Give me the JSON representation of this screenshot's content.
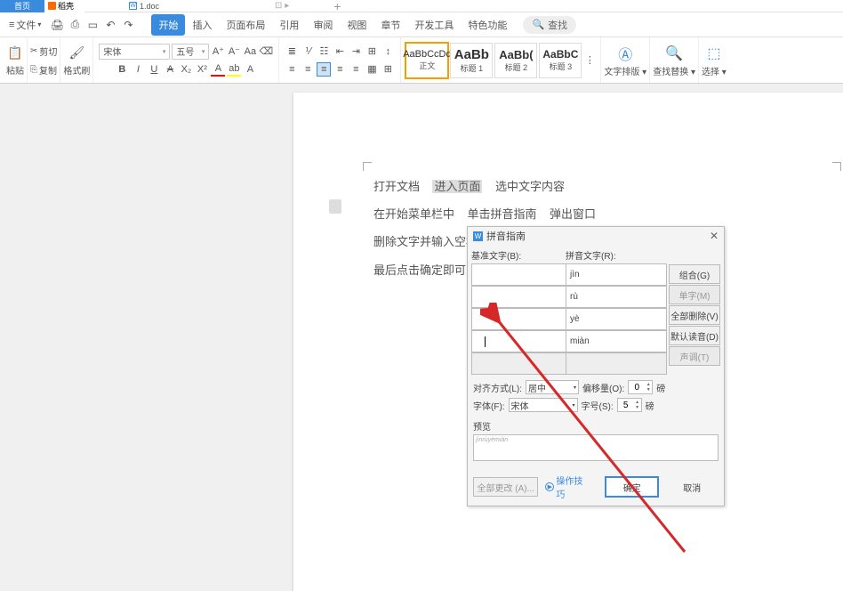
{
  "tabs": {
    "home": "首页",
    "kdocs": "稻壳",
    "doc": "1.doc",
    "pin": "⊡ ▸",
    "plus": "+"
  },
  "menubar": {
    "file": "文件",
    "tabs": [
      "开始",
      "插入",
      "页面布局",
      "引用",
      "审阅",
      "视图",
      "章节",
      "开发工具",
      "特色功能"
    ],
    "search": "查找"
  },
  "ribbon": {
    "paste": "粘贴",
    "cut": "剪切",
    "copy": "复制",
    "fmtpainter": "格式刷",
    "font_name": "宋体",
    "font_size": "五号",
    "styles": [
      {
        "prev": "AaBbCcDd",
        "name": "正文"
      },
      {
        "prev": "AaBb",
        "name": "标题 1"
      },
      {
        "prev": "AaBb(",
        "name": "标题 2"
      },
      {
        "prev": "AaBbC",
        "name": "标题 3"
      }
    ],
    "textlayout": "文字排版",
    "findreplace": "查找替换",
    "select": "选择"
  },
  "document": {
    "line1_a": "打开文档",
    "line1_b": "进入页面",
    "line1_c": "选中文字内容",
    "line2_a": "在开始菜单栏中",
    "line2_b": "单击拼音指南",
    "line2_c": "弹出窗口",
    "line3": "删除文字并输入空格",
    "line4": "最后点击确定即可"
  },
  "dialog": {
    "title": "拼音指南",
    "hdr_base": "基准文字(B):",
    "hdr_ruby": "拼音文字(R):",
    "rows": [
      {
        "base": "",
        "ruby": "jìn"
      },
      {
        "base": "",
        "ruby": "rù"
      },
      {
        "base": "",
        "ruby": "yè"
      },
      {
        "base": "",
        "ruby": "miàn"
      },
      {
        "base": "",
        "ruby": ""
      }
    ],
    "btn_group": "组合(G)",
    "btn_single": "单字(M)",
    "btn_clearall": "全部删除(V)",
    "btn_default": "默认读音(D)",
    "btn_tone": "声调(T)",
    "align_lbl": "对齐方式(L):",
    "align_val": "居中",
    "offset_lbl": "偏移量(O):",
    "offset_val": "0",
    "offset_unit": "磅",
    "font_lbl": "字体(F):",
    "font_val": "宋体",
    "size_lbl": "字号(S):",
    "size_val": "5",
    "size_unit": "磅",
    "preview_lbl": "预览",
    "preview_hint": "jìnrùyèmiàn",
    "btn_changeall": "全部更改 (A)...",
    "link_tips": "操作技巧",
    "btn_ok": "确定",
    "btn_cancel": "取消"
  }
}
